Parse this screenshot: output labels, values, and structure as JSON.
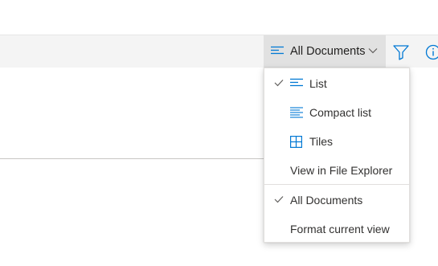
{
  "command_bar": {
    "view_label": "All Documents",
    "icons": {
      "view": "lines-icon",
      "dropdown": "chevron-down-icon",
      "filter": "filter-icon",
      "info": "info-icon"
    }
  },
  "menu": {
    "items": [
      {
        "label": "List",
        "checked": true,
        "icon": "list-icon"
      },
      {
        "label": "Compact list",
        "checked": false,
        "icon": "compact-list-icon"
      },
      {
        "label": "Tiles",
        "checked": false,
        "icon": "tiles-icon"
      },
      {
        "label": "View in File Explorer",
        "checked": false,
        "icon": ""
      },
      {
        "label": "All Documents",
        "checked": true,
        "icon": ""
      },
      {
        "label": "Format current view",
        "checked": false,
        "icon": ""
      }
    ]
  },
  "colors": {
    "accent": "#0078d4",
    "bar_bg": "#f4f4f4",
    "switcher_bg": "#e1e1e1"
  }
}
